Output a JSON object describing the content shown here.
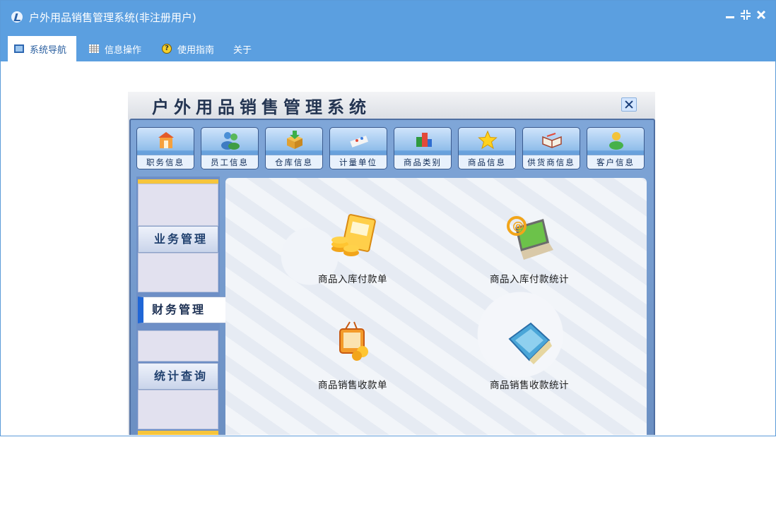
{
  "window": {
    "title": "户外用品销售管理系统(非注册用户)",
    "icons": {
      "app": "app-logo-icon",
      "minimize": "minimize-icon",
      "restore": "restore-icon",
      "close": "close-icon"
    }
  },
  "menubar": {
    "items": [
      {
        "label": "系统导航",
        "icon": "monitor-icon",
        "active": true
      },
      {
        "label": "信息操作",
        "icon": "grid-icon"
      },
      {
        "label": "使用指南",
        "icon": "help-icon"
      },
      {
        "label": "关于"
      }
    ]
  },
  "panel": {
    "title": "户外用品销售管理系统",
    "toolbar": [
      {
        "label": "职务信息",
        "icon": "house-gift-icon"
      },
      {
        "label": "员工信息",
        "icon": "people-icon"
      },
      {
        "label": "仓库信息",
        "icon": "box-download-icon"
      },
      {
        "label": "计量单位",
        "icon": "ruler-icon"
      },
      {
        "label": "商品类别",
        "icon": "blocks-icon"
      },
      {
        "label": "商品信息",
        "icon": "star-icon"
      },
      {
        "label": "供货商信息",
        "icon": "open-book-icon"
      },
      {
        "label": "客户信息",
        "icon": "person-icon"
      }
    ],
    "nav": [
      {
        "label": "业务管理"
      },
      {
        "label": "财务管理",
        "active": true
      },
      {
        "label": "统计查询"
      }
    ],
    "functions": [
      {
        "label": "商品入库付款单",
        "icon": "coins-card-icon"
      },
      {
        "label": "商品入库付款统计",
        "icon": "laptop-email-icon"
      },
      {
        "label": "商品销售收款单",
        "icon": "tv-coins-icon"
      },
      {
        "label": "商品销售收款统计",
        "icon": "folder-icon"
      }
    ]
  },
  "colors": {
    "titlebar": "#5b9fe0",
    "accent": "#1f66d6",
    "nav_gold": "#f6c53c"
  }
}
